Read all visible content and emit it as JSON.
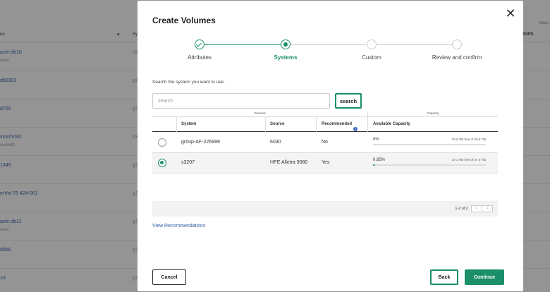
{
  "background": {
    "header": {
      "col1": "ne",
      "col2": "Sy",
      "col3": "IOPS"
    },
    "top_right": "Metric",
    "rows": [
      {
        "name": "acle-db10",
        "sub": "fetere",
        "col2": "s3"
      },
      {
        "name": "db0303",
        "sub": "",
        "col2": "g7"
      },
      {
        "name": "d756",
        "sub": "",
        "col2": "g7"
      },
      {
        "name": "vice2Vol0",
        "sub": "ckstVol01",
        "col2": "s3"
      },
      {
        "name": "1345",
        "sub": "",
        "col2": "g7"
      },
      {
        "name": "erVol-75 424-001",
        "sub": "",
        "col2": "g7"
      },
      {
        "name": "acle-db11",
        "sub": "fetere",
        "col2": "g7"
      },
      {
        "name": "d956",
        "sub": "",
        "col2": "g7"
      },
      {
        "name": "10",
        "sub": "",
        "col2": "g7"
      }
    ]
  },
  "modal": {
    "title": "Create Volumes",
    "close_icon": "close-icon",
    "steps": [
      {
        "label": "Attributes",
        "state": "done"
      },
      {
        "label": "Systems",
        "state": "current"
      },
      {
        "label": "Custom",
        "state": "todo"
      },
      {
        "label": "Review and confirm",
        "state": "todo"
      }
    ],
    "search": {
      "label": "Search the system you want to use.",
      "placeholder": "search",
      "value": "",
      "button": "search"
    },
    "table": {
      "group_general": "General",
      "group_capacity": "Capacity",
      "headers": {
        "system": "System",
        "source": "Source",
        "recommended": "Recommended",
        "capacity": "Available Capacity"
      },
      "rows": [
        {
          "selected": false,
          "system": "group-AF-226999",
          "source": "6030",
          "recommended": "No",
          "capacity_pct": "0%",
          "capacity_fraction": 0.0,
          "capacity_free": "29.6 TiB free of 29.6 TiB"
        },
        {
          "selected": true,
          "system": "s3207",
          "source": "HPE Alletra 9080",
          "recommended": "Yes",
          "capacity_pct": "0.85%",
          "capacity_fraction": 0.0085,
          "capacity_free": "37.1 TiB free of 37.4 TiB"
        }
      ],
      "pager_text": "1-2 of 2",
      "pager_prev": "<",
      "pager_next": ">"
    },
    "view_recommendations": "View Recommendations",
    "buttons": {
      "cancel": "Cancel",
      "back": "Back",
      "continue": "Continue"
    },
    "colors": {
      "accent": "#1b8f6a",
      "link": "#2f5fa3"
    }
  }
}
